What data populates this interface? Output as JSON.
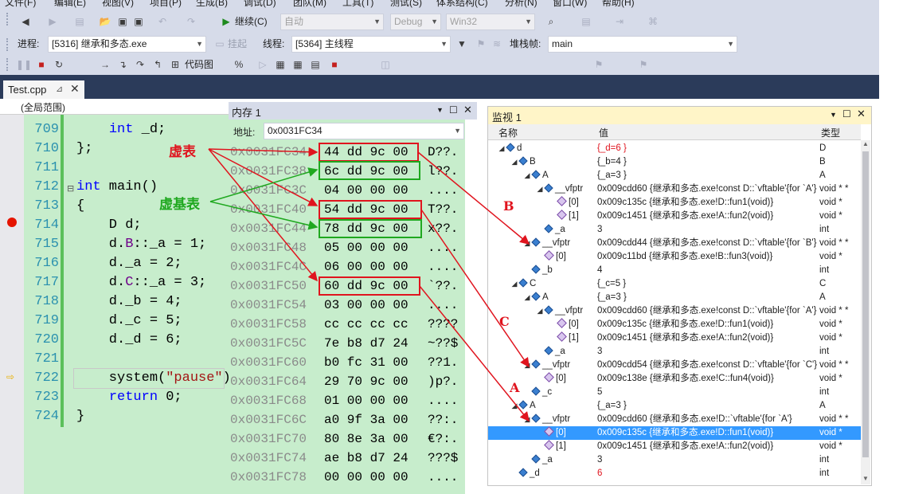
{
  "menu": [
    "文件(F)",
    "编辑(E)",
    "视图(V)",
    "项目(P)",
    "生成(B)",
    "调试(D)",
    "团队(M)",
    "工具(T)",
    "测试(S)",
    "体系结构(C)",
    "分析(N)",
    "窗口(W)",
    "帮助(H)"
  ],
  "toolbar": {
    "continue_label": "继续(C)",
    "auto_combo": "自动",
    "config_combo": "Debug",
    "platform_combo": "Win32",
    "process_label": "进程:",
    "process_value": "[5316] 继承和多态.exe",
    "suspend_label": "挂起",
    "thread_label": "线程:",
    "thread_value": "[5364] 主线程",
    "stackframe_label": "堆栈帧:",
    "stackframe_value": "main",
    "codemap_label": "代码图"
  },
  "editor": {
    "tab_label": "Test.cpp",
    "scope_label": "(全局范围)",
    "lines": [
      {
        "no": "709",
        "segments": [
          {
            "t": "    "
          },
          {
            "t": "int",
            "c": "kw"
          },
          {
            "t": " _d;"
          }
        ]
      },
      {
        "no": "710",
        "segments": [
          {
            "t": "};"
          }
        ]
      },
      {
        "no": "711",
        "segments": [
          {
            "t": ""
          }
        ]
      },
      {
        "no": "712",
        "segments": [
          {
            "t": "int",
            "c": "kw"
          },
          {
            "t": " main()"
          }
        ]
      },
      {
        "no": "713",
        "segments": [
          {
            "t": "{"
          }
        ]
      },
      {
        "no": "714",
        "segments": [
          {
            "t": "    D d;"
          }
        ]
      },
      {
        "no": "715",
        "segments": [
          {
            "t": "    d."
          },
          {
            "t": "B",
            "c": "id"
          },
          {
            "t": "::_a = 1;"
          }
        ]
      },
      {
        "no": "716",
        "segments": [
          {
            "t": "    d._a = 2;"
          }
        ]
      },
      {
        "no": "717",
        "segments": [
          {
            "t": "    d."
          },
          {
            "t": "C",
            "c": "id"
          },
          {
            "t": "::_a = 3;"
          }
        ]
      },
      {
        "no": "718",
        "segments": [
          {
            "t": "    d._b = 4;"
          }
        ]
      },
      {
        "no": "719",
        "segments": [
          {
            "t": "    d._c = 5;"
          }
        ]
      },
      {
        "no": "720",
        "segments": [
          {
            "t": "    d._d = 6;"
          }
        ]
      },
      {
        "no": "721",
        "segments": [
          {
            "t": ""
          }
        ]
      },
      {
        "no": "722",
        "segments": [
          {
            "t": "    system("
          },
          {
            "t": "\"pause\"",
            "c": "str"
          },
          {
            "t": ")"
          }
        ]
      },
      {
        "no": "723",
        "segments": [
          {
            "t": "    "
          },
          {
            "t": "return",
            "c": "kw"
          },
          {
            "t": " 0;"
          }
        ]
      },
      {
        "no": "724",
        "segments": [
          {
            "t": "}"
          }
        ]
      }
    ]
  },
  "memory": {
    "title": "内存 1",
    "address_label": "地址:",
    "address_value": "0x0031FC34",
    "rows": [
      {
        "addr": "0x0031FC34",
        "bytes": "44 dd 9c 00",
        "chars": "D??."
      },
      {
        "addr": "0x0031FC38",
        "bytes": "6c dd 9c 00",
        "chars": "l??."
      },
      {
        "addr": "0x0031FC3C",
        "bytes": "04 00 00 00",
        "chars": "...."
      },
      {
        "addr": "0x0031FC40",
        "bytes": "54 dd 9c 00",
        "chars": "T??."
      },
      {
        "addr": "0x0031FC44",
        "bytes": "78 dd 9c 00",
        "chars": "x??."
      },
      {
        "addr": "0x0031FC48",
        "bytes": "05 00 00 00",
        "chars": "...."
      },
      {
        "addr": "0x0031FC4C",
        "bytes": "06 00 00 00",
        "chars": "...."
      },
      {
        "addr": "0x0031FC50",
        "bytes": "60 dd 9c 00",
        "chars": "`??."
      },
      {
        "addr": "0x0031FC54",
        "bytes": "03 00 00 00",
        "chars": "...."
      },
      {
        "addr": "0x0031FC58",
        "bytes": "cc cc cc cc",
        "chars": "????"
      },
      {
        "addr": "0x0031FC5C",
        "bytes": "7e b8 d7 24",
        "chars": "~??$"
      },
      {
        "addr": "0x0031FC60",
        "bytes": "b0 fc 31 00",
        "chars": "??1."
      },
      {
        "addr": "0x0031FC64",
        "bytes": "29 70 9c 00",
        "chars": ")p?."
      },
      {
        "addr": "0x0031FC68",
        "bytes": "01 00 00 00",
        "chars": "...."
      },
      {
        "addr": "0x0031FC6C",
        "bytes": "a0 9f 3a 00",
        "chars": "??:."
      },
      {
        "addr": "0x0031FC70",
        "bytes": "80 8e 3a 00",
        "chars": "€?:."
      },
      {
        "addr": "0x0031FC74",
        "bytes": "ae b8 d7 24",
        "chars": "???$"
      },
      {
        "addr": "0x0031FC78",
        "bytes": "00 00 00 00",
        "chars": "...."
      }
    ]
  },
  "watch": {
    "title": "监视 1",
    "col_name": "名称",
    "col_value": "值",
    "col_type": "类型",
    "rows": [
      {
        "indent": 0,
        "tri": "◢",
        "icon": "cube",
        "name": "d",
        "value": "{_d=6 }",
        "type": "D",
        "red": true
      },
      {
        "indent": 1,
        "tri": "◢",
        "icon": "cube",
        "name": "B",
        "value": "{_b=4 }",
        "type": "B"
      },
      {
        "indent": 2,
        "tri": "◢",
        "icon": "cube",
        "name": "A",
        "value": "{_a=3 }",
        "type": "A"
      },
      {
        "indent": 3,
        "tri": "◢",
        "icon": "cube",
        "name": "__vfptr",
        "value": "0x009cdd60 {继承和多态.exe!const D::`vftable'{for `A'}",
        "type": "void * *"
      },
      {
        "indent": 4,
        "tri": "",
        "icon": "vfn",
        "name": "[0]",
        "value": "0x009c135c {继承和多态.exe!D::fun1(void)}",
        "type": "void *"
      },
      {
        "indent": 4,
        "tri": "",
        "icon": "vfn",
        "name": "[1]",
        "value": "0x009c1451 {继承和多态.exe!A::fun2(void)}",
        "type": "void *"
      },
      {
        "indent": 3,
        "tri": "",
        "icon": "cube",
        "name": "_a",
        "value": "3",
        "type": "int"
      },
      {
        "indent": 2,
        "tri": "◢",
        "icon": "cube",
        "name": "__vfptr",
        "value": "0x009cdd44 {继承和多态.exe!const D::`vftable'{for `B'}",
        "type": "void * *"
      },
      {
        "indent": 3,
        "tri": "",
        "icon": "vfn",
        "name": "[0]",
        "value": "0x009c11bd {继承和多态.exe!B::fun3(void)}",
        "type": "void *"
      },
      {
        "indent": 2,
        "tri": "",
        "icon": "cube",
        "name": "_b",
        "value": "4",
        "type": "int"
      },
      {
        "indent": 1,
        "tri": "◢",
        "icon": "cube",
        "name": "C",
        "value": "{_c=5 }",
        "type": "C"
      },
      {
        "indent": 2,
        "tri": "◢",
        "icon": "cube",
        "name": "A",
        "value": "{_a=3 }",
        "type": "A"
      },
      {
        "indent": 3,
        "tri": "◢",
        "icon": "cube",
        "name": "__vfptr",
        "value": "0x009cdd60 {继承和多态.exe!const D::`vftable'{for `A'}",
        "type": "void * *"
      },
      {
        "indent": 4,
        "tri": "",
        "icon": "vfn",
        "name": "[0]",
        "value": "0x009c135c {继承和多态.exe!D::fun1(void)}",
        "type": "void *"
      },
      {
        "indent": 4,
        "tri": "",
        "icon": "vfn",
        "name": "[1]",
        "value": "0x009c1451 {继承和多态.exe!A::fun2(void)}",
        "type": "void *"
      },
      {
        "indent": 3,
        "tri": "",
        "icon": "cube",
        "name": "_a",
        "value": "3",
        "type": "int"
      },
      {
        "indent": 2,
        "tri": "◢",
        "icon": "cube",
        "name": "__vfptr",
        "value": "0x009cdd54 {继承和多态.exe!const D::`vftable'{for `C'}",
        "type": "void * *"
      },
      {
        "indent": 3,
        "tri": "",
        "icon": "vfn",
        "name": "[0]",
        "value": "0x009c138e {继承和多态.exe!C::fun4(void)}",
        "type": "void *"
      },
      {
        "indent": 2,
        "tri": "",
        "icon": "cube",
        "name": "_c",
        "value": "5",
        "type": "int"
      },
      {
        "indent": 1,
        "tri": "◢",
        "icon": "cube",
        "name": "A",
        "value": "{_a=3 }",
        "type": "A"
      },
      {
        "indent": 2,
        "tri": "◢",
        "icon": "cube",
        "name": "__vfptr",
        "value": "0x009cdd60 {继承和多态.exe!D::`vftable'{for `A'}",
        "type": "void * *"
      },
      {
        "indent": 3,
        "tri": "",
        "icon": "vfn",
        "name": "[0]",
        "value": "0x009c135c {继承和多态.exe!D::fun1(void)}",
        "type": "void *",
        "selected": true
      },
      {
        "indent": 3,
        "tri": "",
        "icon": "vfn",
        "name": "[1]",
        "value": "0x009c1451 {继承和多态.exe!A::fun2(void)}",
        "type": "void *"
      },
      {
        "indent": 2,
        "tri": "",
        "icon": "cube",
        "name": "_a",
        "value": "3",
        "type": "int"
      },
      {
        "indent": 1,
        "tri": "",
        "icon": "cube",
        "name": "_d",
        "value": "6",
        "type": "int",
        "red": true
      }
    ]
  },
  "annotations": {
    "vtable_label": "虚表",
    "vbtable_label": "虚基表",
    "label_b": "B",
    "label_c": "C",
    "label_a": "A"
  },
  "colors": {
    "annotation_red": "#e0141e",
    "annotation_green": "#1fa81f",
    "editor_bg": "#c7edcc",
    "selection": "#3399ff"
  }
}
